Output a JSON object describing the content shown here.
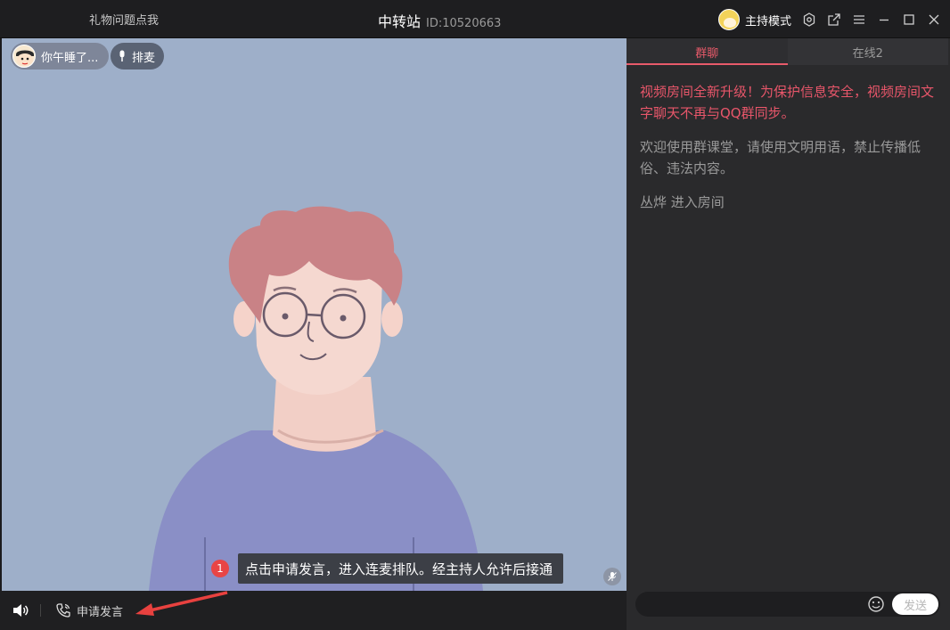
{
  "titlebar": {
    "left_link": "礼物问题点我",
    "title": "中转站",
    "room_id": "ID:10520663",
    "host_mode": "主持模式"
  },
  "icons": {
    "settings": "gear-icon",
    "share": "share-icon",
    "menu": "menu-icon",
    "minimize": "minimize-icon",
    "maximize": "maximize-icon",
    "close": "close-icon"
  },
  "video": {
    "user_name": "你午睡了...",
    "queue_label": "排麦",
    "tooltip_badge": "1",
    "tooltip_text": "点击申请发言，进入连麦排队。经主持人允许后接通"
  },
  "bottombar": {
    "apply_label": "申请发言"
  },
  "panel": {
    "tabs": [
      {
        "label": "群聊",
        "active": true
      },
      {
        "label": "在线2",
        "active": false
      }
    ],
    "messages": [
      {
        "type": "notice",
        "text": "视频房间全新升级！为保护信息安全，视频房间文字聊天不再与QQ群同步。"
      },
      {
        "type": "info",
        "text": "欢迎使用群课堂，请使用文明用语，禁止传播低俗、违法内容。"
      },
      {
        "type": "join",
        "text": "丛烨 进入房间"
      }
    ],
    "send_label": "发送"
  },
  "colors": {
    "accent": "#e85a6a",
    "video_bg": "#9eafc9",
    "panel_bg": "#2a2a2c",
    "titlebar_bg": "#1e1e20"
  }
}
